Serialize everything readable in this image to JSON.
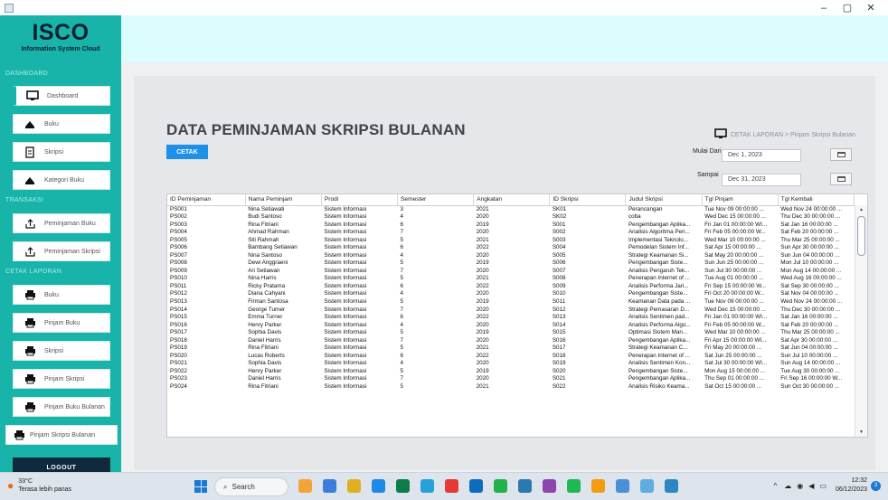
{
  "window": {
    "minimize": "–",
    "maximize": "▢",
    "close": "✕"
  },
  "brand": {
    "title": "ISCO",
    "subtitle": "Information System Cloud"
  },
  "sidebar": {
    "sections": [
      "DASHBOARD",
      "TRANSAKSI",
      "CETAK LAPORAN"
    ],
    "items": [
      {
        "label": "Dashboard",
        "icon": "monitor-icon"
      },
      {
        "label": "Buku",
        "icon": "books-icon"
      },
      {
        "label": "Skripsi",
        "icon": "document-icon"
      },
      {
        "label": "Kategori Buku",
        "icon": "books-icon"
      },
      {
        "label": "Peminjaman Buku",
        "icon": "upload-icon"
      },
      {
        "label": "Peminjaman Skripsi",
        "icon": "upload-icon"
      },
      {
        "label": "Buku",
        "icon": "printer-icon"
      },
      {
        "label": "Pinjam Buku",
        "icon": "printer-icon"
      },
      {
        "label": "Skripsi",
        "icon": "printer-icon"
      },
      {
        "label": "Pinjam Skripsi",
        "icon": "printer-icon"
      },
      {
        "label": "Pinjam Buku Bulanan",
        "icon": "printer-icon"
      },
      {
        "label": "Pinjam Skripsi Bulanan",
        "icon": "printer-icon"
      }
    ],
    "logout": "LOGOUT"
  },
  "main": {
    "title": "DATA PEMINJAMAN SKRIPSI BULANAN",
    "breadcrumb": "CETAK LAPORAN > Pinjam Skripsi Bulanan",
    "cetak": "CETAK",
    "mulai_label": "Mulai Dari",
    "mulai_value": "Dec 1, 2023",
    "sampai_label": "Sampai",
    "sampai_value": "Dec 31, 2023"
  },
  "table": {
    "columns": [
      "ID Peminjaman",
      "Nama Peminjam",
      "Prodi",
      "Semester",
      "Angkatan",
      "ID Skripsi",
      "Judul Skripsi",
      "Tgl Pinjam",
      "Tgl Kembali"
    ],
    "rows": [
      [
        "PS001",
        "Nina Setiawati",
        "Sistem Informasi",
        "3",
        "2021",
        "SK01",
        "Perancangan",
        "Tue Nov 09 00:00:00 ...",
        "Wed Nov 24 00:00:00 ..."
      ],
      [
        "PS002",
        "Budi Santoso",
        "Sistem Informasi",
        "4",
        "2020",
        "SK02",
        "coba",
        "Wed Dec 15 00:00:00 ...",
        "Thu Dec 30 00:00:00 ..."
      ],
      [
        "PS003",
        "Rina Fitriani",
        "Sistem Informasi",
        "6",
        "2019",
        "S001",
        "Pengembangan Aplika...",
        "Fri Jan 01 00:00:00 WI...",
        "Sat Jan 16 00:00:00 ..."
      ],
      [
        "PS004",
        "Ahmad Rahman",
        "Sistem Informasi",
        "7",
        "2020",
        "S002",
        "Analisis Algoritma Pen...",
        "Fri Feb 05 00:00:00 W...",
        "Sat Feb 20 00:00:00 ..."
      ],
      [
        "PS005",
        "Siti Rahmah",
        "Sistem Informasi",
        "5",
        "2021",
        "S003",
        "Implementasi Teknolo...",
        "Wed Mar 10 00:00:00 ...",
        "Thu Mar 25 00:00:00 ..."
      ],
      [
        "PS006",
        "Bambang Setiawan",
        "Sistem Informasi",
        "6",
        "2022",
        "S004",
        "Pemodelan Sistem Inf...",
        "Sat Apr 15 00:00:00 ...",
        "Sun Apr 30 00:00:00 ..."
      ],
      [
        "PS007",
        "Nina Santoso",
        "Sistem Informasi",
        "4",
        "2020",
        "S005",
        "Strategi Keamanan Si...",
        "Sat May 20 00:00:00 ...",
        "Sun Jun 04 00:00:00 ..."
      ],
      [
        "PS008",
        "Dewi Anggraeni",
        "Sistem Informasi",
        "5",
        "2019",
        "S006",
        "Pengembangan Siste...",
        "Sun Jun 25 00:00:00 ...",
        "Mon Jul 10 00:00:00 ..."
      ],
      [
        "PS009",
        "Ari Setiawan",
        "Sistem Informasi",
        "7",
        "2020",
        "S007",
        "Analisis Pengaruh Tek...",
        "Sun Jul 30 00:00:00 ...",
        "Mon Aug 14 00:00:00 ..."
      ],
      [
        "PS010",
        "Nina Harris",
        "Sistem Informasi",
        "5",
        "2021",
        "S008",
        "Penerapan Internet of ...",
        "Tue Aug 01 00:00:00 ...",
        "Wed Aug 16 00:00:00 ..."
      ],
      [
        "PS011",
        "Ricky Pratama",
        "Sistem Informasi",
        "6",
        "2022",
        "S009",
        "Analisis Performa Jari...",
        "Fri Sep 15 00:00:00 W...",
        "Sat Sep 30 00:00:00 ..."
      ],
      [
        "PS012",
        "Diana Cahyani",
        "Sistem Informasi",
        "4",
        "2020",
        "S010",
        "Pengembangan Siste...",
        "Fri Oct 20 00:00:00 W...",
        "Sat Nov 04 00:00:00 ..."
      ],
      [
        "PS013",
        "Firman Santosa",
        "Sistem Informasi",
        "5",
        "2019",
        "S011",
        "Keamanan Data pada ...",
        "Tue Nov 09 00:00:00 ...",
        "Wed Nov 24 00:00:00 ..."
      ],
      [
        "PS014",
        "George Turner",
        "Sistem Informasi",
        "7",
        "2020",
        "S012",
        "Strategi Pemasaran D...",
        "Wed Dec 15 00:00:00 ...",
        "Thu Dec 30 00:00:00 ..."
      ],
      [
        "PS015",
        "Emma Turner",
        "Sistem Informasi",
        "6",
        "2022",
        "S013",
        "Analisis Sentimen pad...",
        "Fri Jan 01 00:00:00 WI...",
        "Sat Jan 16 00:00:00 ..."
      ],
      [
        "PS016",
        "Henry Parker",
        "Sistem Informasi",
        "4",
        "2020",
        "S014",
        "Analisis Performa Algo...",
        "Fri Feb 05 00:00:00 W...",
        "Sat Feb 20 00:00:00 ..."
      ],
      [
        "PS017",
        "Sophia Davis",
        "Sistem Informasi",
        "5",
        "2019",
        "S015",
        "Optimasi Sistem Man...",
        "Wed Mar 10 00:00:00 ...",
        "Thu Mar 25 00:00:00 ..."
      ],
      [
        "PS018",
        "Daniel Harris",
        "Sistem Informasi",
        "7",
        "2020",
        "S016",
        "Pengembangan Aplika...",
        "Fri Apr 15 00:00:00 WI...",
        "Sat Apr 30 00:00:00 ..."
      ],
      [
        "PS019",
        "Rina Fitriani",
        "Sistem Informasi",
        "5",
        "2021",
        "S017",
        "Strategi Keamanan C...",
        "Fri May 20 00:00:00 ...",
        "Sat Jun 04 00:00:00 ..."
      ],
      [
        "PS020",
        "Lucas Roberts",
        "Sistem Informasi",
        "6",
        "2022",
        "S018",
        "Penerapan Internet of ...",
        "Sat Jun 25 00:00:00 ...",
        "Sun Jul 10 00:00:00 ..."
      ],
      [
        "PS021",
        "Sophia Davis",
        "Sistem Informasi",
        "4",
        "2020",
        "S019",
        "Analisis Sentimen Kon...",
        "Sat Jul 30 00:00:00 WI...",
        "Sun Aug 14 00:00:00 ..."
      ],
      [
        "PS022",
        "Henry Parker",
        "Sistem Informasi",
        "5",
        "2019",
        "S020",
        "Pengembangan Siste...",
        "Mon Aug 15 00:00:00 ...",
        "Tue Aug 30 00:00:00 ..."
      ],
      [
        "PS023",
        "Daniel Harris",
        "Sistem Informasi",
        "7",
        "2020",
        "S021",
        "Pengembangan Aplika...",
        "Thu Sep 01 00:00:00 ...",
        "Fri Sep 16 00:00:00 W..."
      ],
      [
        "PS024",
        "Rina Fitriani",
        "Sistem Informasi",
        "5",
        "2021",
        "S022",
        "Analisis Risiko Keama...",
        "Sat Oct 15 00:00:00 ...",
        "Sun Oct 30 00:00:00 ..."
      ]
    ]
  },
  "taskbar": {
    "temp": "33°C",
    "weather": "Terasa lebih panas",
    "search": "Search",
    "time": "12:32",
    "date": "06/12/2023",
    "notif_count": "3",
    "apps": [
      "#f2a43a",
      "#3b7dd8",
      "#e0b020",
      "#1e88e5",
      "#0e7c4a",
      "#26a0da",
      "#e53935",
      "#0f6cbd",
      "#22b14c",
      "#2a7ab0",
      "#8e44ad",
      "#1db954",
      "#f39c12",
      "#4a90d9",
      "#5dade2",
      "#2e86c1"
    ]
  },
  "colors": {
    "accent": "#18b4a9",
    "banner": "#dcfdfd",
    "button": "#1e90e8",
    "logout": "#0f2a3c"
  }
}
